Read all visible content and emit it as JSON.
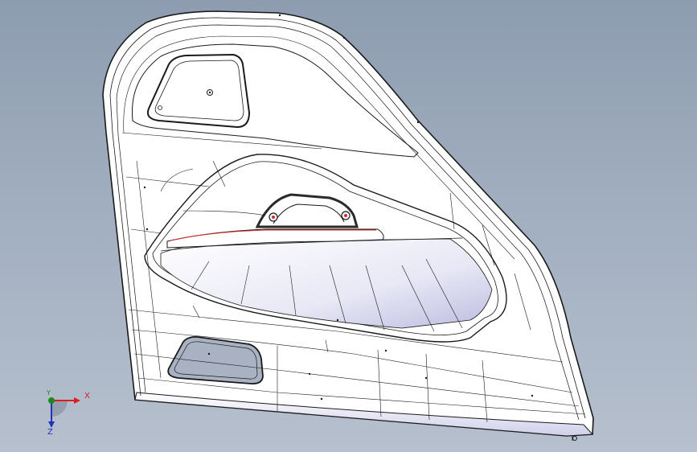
{
  "viewport": {
    "background_top": "#8d9cb0",
    "background_bottom": "#b6c0ce"
  },
  "model": {
    "part": "door-trim-panel",
    "surface_fill": "#ffffff",
    "edge_color": "#1a1a1a",
    "shade_color": "#c9c8e6",
    "highlight_edge_color": "#d42a2a",
    "fastener_icons": [
      "screw-hole-icon",
      "screw-hole-icon"
    ]
  },
  "triad": {
    "x_label": "X",
    "y_label": "Y",
    "z_label": "Z",
    "x_color": "#d81e1e",
    "y_color": "#1a8a1a",
    "z_color": "#2233b8",
    "icons": [
      "x-axis-arrow-icon",
      "y-axis-dot-icon",
      "z-axis-arrow-icon"
    ]
  }
}
